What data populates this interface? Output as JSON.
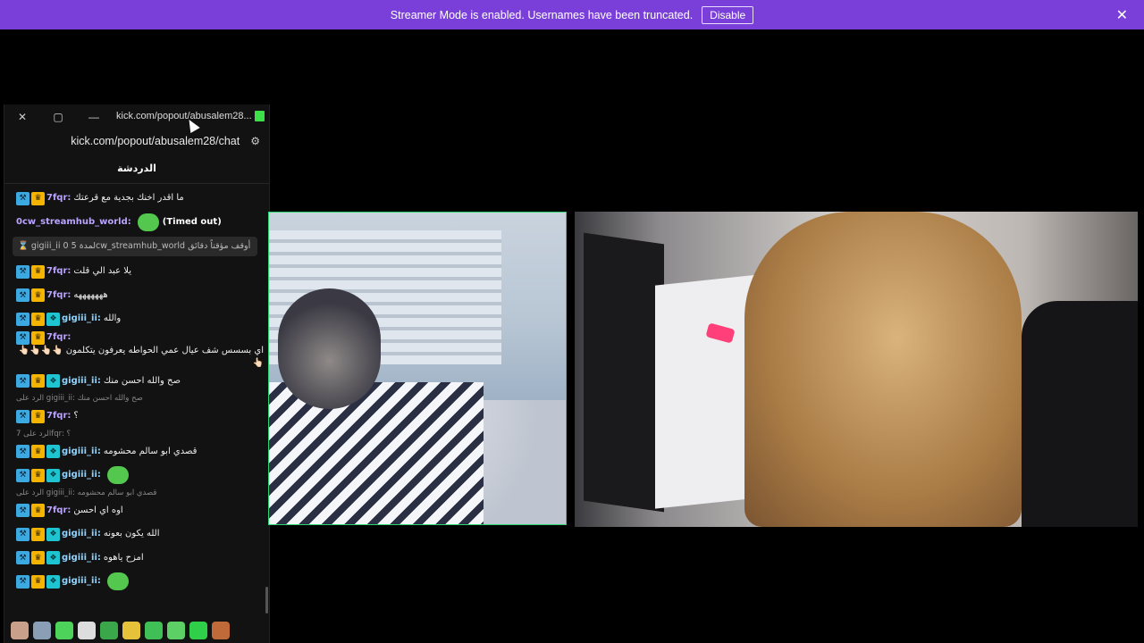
{
  "banner": {
    "message": "Streamer Mode is enabled. Usernames have been truncated.",
    "disable_label": "Disable",
    "close_icon": "✕",
    "color": "#7a3fd9"
  },
  "window": {
    "title": "kick.com/popout/abusalem28...",
    "url": "kick.com/popout/abusalem28/chat",
    "close_icon": "✕",
    "maximize_icon": "▢",
    "minimize_icon": "—",
    "settings_icon": "⚙"
  },
  "chat": {
    "header": "الدردشة",
    "messages": [
      {
        "user": "7fqr:",
        "text": "ما اقدر اخنك بجدية مع قرعتك"
      },
      {
        "user": "0cw_streamhub_world:",
        "text": "(Timed out)"
      },
      {
        "notice": "gigiii_ii لمدة 5 0cw_streamhub_world أوقف مؤقتاً دقائق"
      },
      {
        "user": "7fqr:",
        "text": "يلا عبد الي قلت"
      },
      {
        "user": "7fqr:",
        "text": "هههههههه"
      },
      {
        "user": "gigiii_ii:",
        "text": "والله"
      },
      {
        "user": "7fqr:",
        "text": "اي بسسس شف عيال عمي الحواطه يعرفون يتكلمون 👆🏻👆🏻👆🏻👆🏻👆🏻"
      },
      {
        "user": "gigiii_ii:",
        "text": "صح والله احسن منك"
      },
      {
        "reply": "الرد على gigiii_ii: صح والله احسن منك",
        "user": "7fqr:",
        "text": "؟"
      },
      {
        "reply": "الرد على 7fqr: ؟",
        "user": "gigiii_ii:",
        "text": "قصدي ابو سالم محشومه"
      },
      {
        "user": "gigiii_ii:",
        "text": ""
      },
      {
        "reply": "الرد على gigiii_ii: قصدي ابو سالم محشومه",
        "user": "7fqr:",
        "text": "اوه اي احسن"
      },
      {
        "user": "gigiii_ii:",
        "text": "الله يكون بعونه"
      },
      {
        "user": "gigiii_ii:",
        "text": "امزح ياهوه"
      },
      {
        "user": "gigiii_ii:",
        "text": ""
      }
    ]
  },
  "colors": {
    "accent_green": "#2ed573",
    "mod_badge": "#3ca9e0",
    "crown_badge": "#f4b400"
  }
}
